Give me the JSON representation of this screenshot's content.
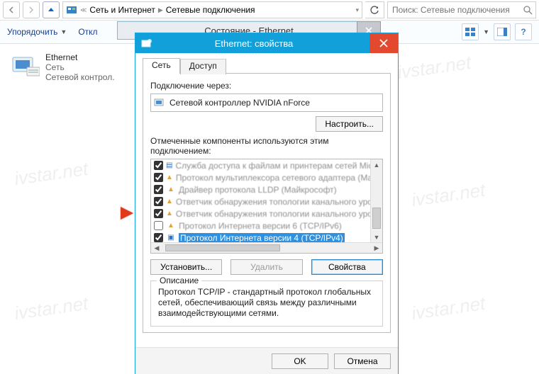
{
  "address_bar": {
    "crumb1": "Сеть и Интернет",
    "crumb2": "Сетевые подключения"
  },
  "search": {
    "placeholder": "Поиск: Сетевые подключения"
  },
  "cmdbar": {
    "organize": "Упорядочить",
    "disable": "Откл"
  },
  "connection_tile": {
    "name": "Ethernet",
    "status": "Сеть",
    "device": "Сетевой контрол."
  },
  "under_dialog": {
    "title": "Состояние - Ethernet"
  },
  "dlg": {
    "title": "Ethernet: свойства",
    "tabs": {
      "net": "Сеть",
      "access": "Доступ"
    },
    "connect_via_label": "Подключение через:",
    "connect_via_value": "Сетевой контроллер NVIDIA nForce",
    "configure": "Настроить...",
    "components_label": "Отмеченные компоненты используются этим подключением:",
    "items": [
      {
        "checked": true,
        "icon": "svc",
        "label": "Служба доступа к файлам и принтерам сетей Micro",
        "blur": true
      },
      {
        "checked": true,
        "icon": "tri",
        "label": "Протокол мультиплексора сетевого адаптера (Ma",
        "blur": true
      },
      {
        "checked": true,
        "icon": "tri",
        "label": "Драйвер протокола LLDP (Майкрософт)",
        "blur": true
      },
      {
        "checked": true,
        "icon": "tri",
        "label": "Ответчик обнаружения топологии канального уров",
        "blur": true
      },
      {
        "checked": true,
        "icon": "tri",
        "label": "Ответчик обнаружения топологии канального уров",
        "blur": true
      },
      {
        "checked": false,
        "icon": "tri",
        "label": "Протокол Интернета версии 6 (TCP/IPv6)",
        "blur": true
      },
      {
        "checked": true,
        "icon": "net",
        "label": "Протокол Интернета версии 4 (TCP/IPv4)",
        "blur": false,
        "selected": true
      }
    ],
    "install": "Установить...",
    "remove": "Удалить",
    "props": "Свойства",
    "desc_title": "Описание",
    "desc_text": "Протокол TCP/IP - стандартный протокол глобальных сетей, обеспечивающий связь между различными взаимодействующими сетями.",
    "ok": "OK",
    "cancel": "Отмена"
  },
  "watermark": "ivstar.net"
}
